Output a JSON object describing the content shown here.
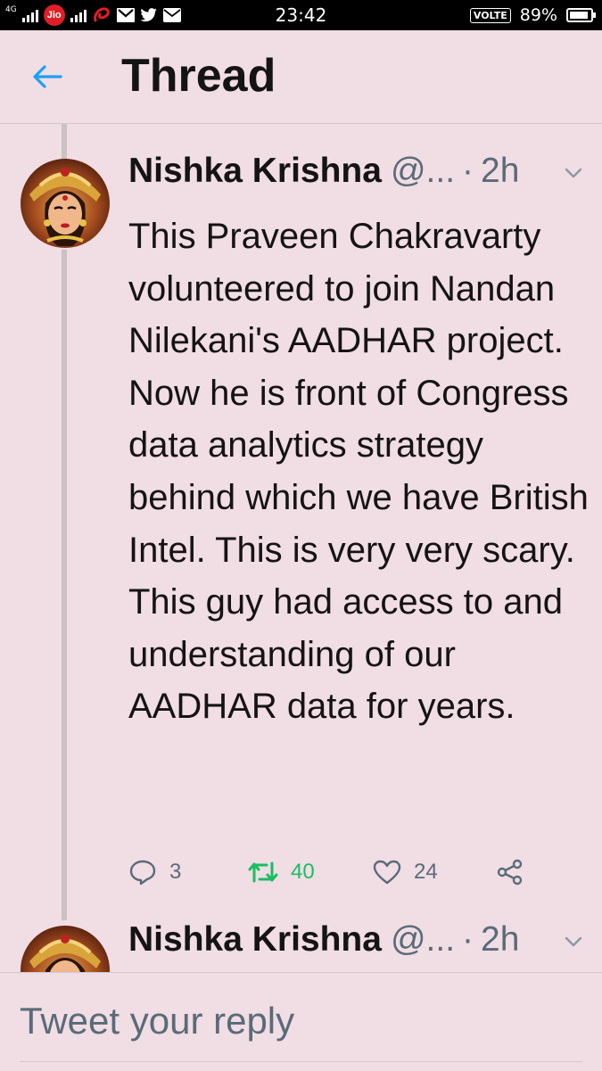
{
  "status_bar": {
    "network_type": "4G",
    "carrier_badge": "Jio",
    "time": "23:42",
    "volte": "VOLTE",
    "battery_percent": "89%",
    "battery_level": 0.89,
    "notification_icons": [
      "airtel-icon",
      "gmail-icon",
      "twitter-icon",
      "mail-icon"
    ]
  },
  "header": {
    "title": "Thread",
    "back_icon": "arrow-left-icon"
  },
  "colors": {
    "background": "#f1dde4",
    "accent": "#1da1f2",
    "retweet_green": "#17bf63",
    "secondary_text": "#5a6b78"
  },
  "tweets": [
    {
      "author_name": "Nishka Krishna",
      "handle": "@...",
      "separator": "·",
      "time": "2h",
      "text": "This Praveen Chakravarty volunteered to join Nandan Nilekani's AADHAR project. Now he is front of Congress data analytics strategy behind which we have British Intel. This is very very scary. This guy had access to and understanding of our AADHAR data for years.",
      "actions": {
        "replies": "3",
        "retweets": "40",
        "likes": "24"
      }
    },
    {
      "author_name": "Nishka Krishna",
      "handle": "@...",
      "separator": "·",
      "time": "2h"
    }
  ],
  "reply": {
    "placeholder": "Tweet your reply"
  }
}
